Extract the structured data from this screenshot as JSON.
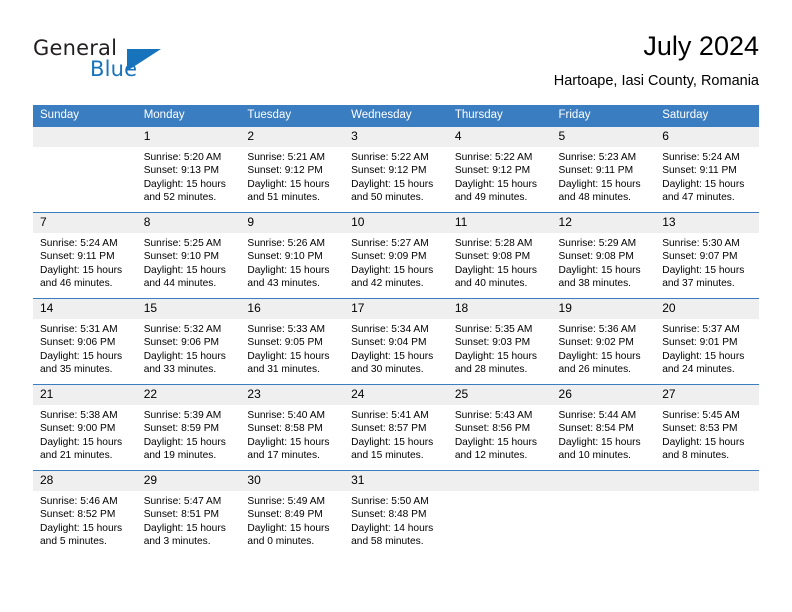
{
  "brand": {
    "word1": "General",
    "word2": "Blue",
    "triangle_color": "#1773bb",
    "text_color": "#231f20"
  },
  "header": {
    "title": "July 2024",
    "subtitle": "Hartoape, Iasi County, Romania"
  },
  "theme": {
    "header_bg": "#3b7dc1",
    "header_text": "#ffffff",
    "daynum_bg": "#efefef",
    "grid_line": "#3b7dc1",
    "body_text": "#000000"
  },
  "weekday_headers": [
    "Sunday",
    "Monday",
    "Tuesday",
    "Wednesday",
    "Thursday",
    "Friday",
    "Saturday"
  ],
  "weeks": [
    [
      {
        "day": "",
        "lines": []
      },
      {
        "day": "1",
        "lines": [
          "Sunrise: 5:20 AM",
          "Sunset: 9:13 PM",
          "Daylight: 15 hours",
          "and 52 minutes."
        ]
      },
      {
        "day": "2",
        "lines": [
          "Sunrise: 5:21 AM",
          "Sunset: 9:12 PM",
          "Daylight: 15 hours",
          "and 51 minutes."
        ]
      },
      {
        "day": "3",
        "lines": [
          "Sunrise: 5:22 AM",
          "Sunset: 9:12 PM",
          "Daylight: 15 hours",
          "and 50 minutes."
        ]
      },
      {
        "day": "4",
        "lines": [
          "Sunrise: 5:22 AM",
          "Sunset: 9:12 PM",
          "Daylight: 15 hours",
          "and 49 minutes."
        ]
      },
      {
        "day": "5",
        "lines": [
          "Sunrise: 5:23 AM",
          "Sunset: 9:11 PM",
          "Daylight: 15 hours",
          "and 48 minutes."
        ]
      },
      {
        "day": "6",
        "lines": [
          "Sunrise: 5:24 AM",
          "Sunset: 9:11 PM",
          "Daylight: 15 hours",
          "and 47 minutes."
        ]
      }
    ],
    [
      {
        "day": "7",
        "lines": [
          "Sunrise: 5:24 AM",
          "Sunset: 9:11 PM",
          "Daylight: 15 hours",
          "and 46 minutes."
        ]
      },
      {
        "day": "8",
        "lines": [
          "Sunrise: 5:25 AM",
          "Sunset: 9:10 PM",
          "Daylight: 15 hours",
          "and 44 minutes."
        ]
      },
      {
        "day": "9",
        "lines": [
          "Sunrise: 5:26 AM",
          "Sunset: 9:10 PM",
          "Daylight: 15 hours",
          "and 43 minutes."
        ]
      },
      {
        "day": "10",
        "lines": [
          "Sunrise: 5:27 AM",
          "Sunset: 9:09 PM",
          "Daylight: 15 hours",
          "and 42 minutes."
        ]
      },
      {
        "day": "11",
        "lines": [
          "Sunrise: 5:28 AM",
          "Sunset: 9:08 PM",
          "Daylight: 15 hours",
          "and 40 minutes."
        ]
      },
      {
        "day": "12",
        "lines": [
          "Sunrise: 5:29 AM",
          "Sunset: 9:08 PM",
          "Daylight: 15 hours",
          "and 38 minutes."
        ]
      },
      {
        "day": "13",
        "lines": [
          "Sunrise: 5:30 AM",
          "Sunset: 9:07 PM",
          "Daylight: 15 hours",
          "and 37 minutes."
        ]
      }
    ],
    [
      {
        "day": "14",
        "lines": [
          "Sunrise: 5:31 AM",
          "Sunset: 9:06 PM",
          "Daylight: 15 hours",
          "and 35 minutes."
        ]
      },
      {
        "day": "15",
        "lines": [
          "Sunrise: 5:32 AM",
          "Sunset: 9:06 PM",
          "Daylight: 15 hours",
          "and 33 minutes."
        ]
      },
      {
        "day": "16",
        "lines": [
          "Sunrise: 5:33 AM",
          "Sunset: 9:05 PM",
          "Daylight: 15 hours",
          "and 31 minutes."
        ]
      },
      {
        "day": "17",
        "lines": [
          "Sunrise: 5:34 AM",
          "Sunset: 9:04 PM",
          "Daylight: 15 hours",
          "and 30 minutes."
        ]
      },
      {
        "day": "18",
        "lines": [
          "Sunrise: 5:35 AM",
          "Sunset: 9:03 PM",
          "Daylight: 15 hours",
          "and 28 minutes."
        ]
      },
      {
        "day": "19",
        "lines": [
          "Sunrise: 5:36 AM",
          "Sunset: 9:02 PM",
          "Daylight: 15 hours",
          "and 26 minutes."
        ]
      },
      {
        "day": "20",
        "lines": [
          "Sunrise: 5:37 AM",
          "Sunset: 9:01 PM",
          "Daylight: 15 hours",
          "and 24 minutes."
        ]
      }
    ],
    [
      {
        "day": "21",
        "lines": [
          "Sunrise: 5:38 AM",
          "Sunset: 9:00 PM",
          "Daylight: 15 hours",
          "and 21 minutes."
        ]
      },
      {
        "day": "22",
        "lines": [
          "Sunrise: 5:39 AM",
          "Sunset: 8:59 PM",
          "Daylight: 15 hours",
          "and 19 minutes."
        ]
      },
      {
        "day": "23",
        "lines": [
          "Sunrise: 5:40 AM",
          "Sunset: 8:58 PM",
          "Daylight: 15 hours",
          "and 17 minutes."
        ]
      },
      {
        "day": "24",
        "lines": [
          "Sunrise: 5:41 AM",
          "Sunset: 8:57 PM",
          "Daylight: 15 hours",
          "and 15 minutes."
        ]
      },
      {
        "day": "25",
        "lines": [
          "Sunrise: 5:43 AM",
          "Sunset: 8:56 PM",
          "Daylight: 15 hours",
          "and 12 minutes."
        ]
      },
      {
        "day": "26",
        "lines": [
          "Sunrise: 5:44 AM",
          "Sunset: 8:54 PM",
          "Daylight: 15 hours",
          "and 10 minutes."
        ]
      },
      {
        "day": "27",
        "lines": [
          "Sunrise: 5:45 AM",
          "Sunset: 8:53 PM",
          "Daylight: 15 hours",
          "and 8 minutes."
        ]
      }
    ],
    [
      {
        "day": "28",
        "lines": [
          "Sunrise: 5:46 AM",
          "Sunset: 8:52 PM",
          "Daylight: 15 hours",
          "and 5 minutes."
        ]
      },
      {
        "day": "29",
        "lines": [
          "Sunrise: 5:47 AM",
          "Sunset: 8:51 PM",
          "Daylight: 15 hours",
          "and 3 minutes."
        ]
      },
      {
        "day": "30",
        "lines": [
          "Sunrise: 5:49 AM",
          "Sunset: 8:49 PM",
          "Daylight: 15 hours",
          "and 0 minutes."
        ]
      },
      {
        "day": "31",
        "lines": [
          "Sunrise: 5:50 AM",
          "Sunset: 8:48 PM",
          "Daylight: 14 hours",
          "and 58 minutes."
        ]
      },
      {
        "day": "",
        "lines": []
      },
      {
        "day": "",
        "lines": []
      },
      {
        "day": "",
        "lines": []
      }
    ]
  ]
}
